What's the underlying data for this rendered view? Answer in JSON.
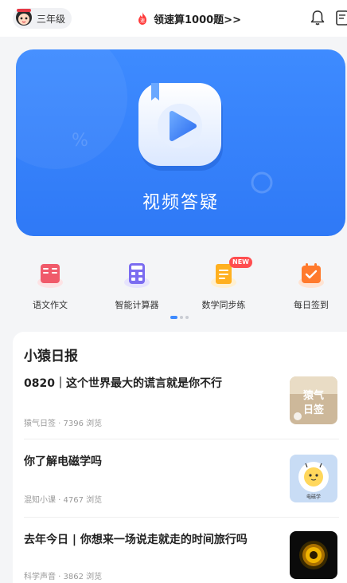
{
  "header": {
    "grade_label": "三年级",
    "promo_text": "领速算1000题>>",
    "icons": [
      "avatar",
      "fire-icon",
      "bell-icon",
      "scan-icon"
    ]
  },
  "hero": {
    "caption": "视频答疑",
    "icon": "video-play-icon",
    "color": "#3e8bff"
  },
  "tools": [
    {
      "label": "语文作文",
      "icon": "notebook-icon",
      "color": "#f05a6a"
    },
    {
      "label": "智能计算器",
      "icon": "calculator-icon",
      "color": "#7b6cf0"
    },
    {
      "label": "数学同步练",
      "icon": "exercise-book-icon",
      "color": "#ffb020",
      "badge": "NEW"
    },
    {
      "label": "每日签到",
      "icon": "calendar-check-icon",
      "color": "#ff7a2d"
    }
  ],
  "pager": {
    "count": 3,
    "active": 1
  },
  "news": {
    "title": "小猿日报",
    "articles": [
      {
        "title": "0820｜这个世界最大的谎言就是你不行",
        "meta": "猿气日签 · 7396 浏览",
        "thumb_text": "猿气日签"
      },
      {
        "title": "你了解电磁学吗",
        "meta": "混知小课 · 4767 浏览",
        "thumb_text": "电磁学"
      },
      {
        "title": "去年今日 | 你想来一场说走就走的时间旅行吗",
        "meta": "科学声音 · 3862 浏览",
        "thumb_text": ""
      }
    ]
  }
}
